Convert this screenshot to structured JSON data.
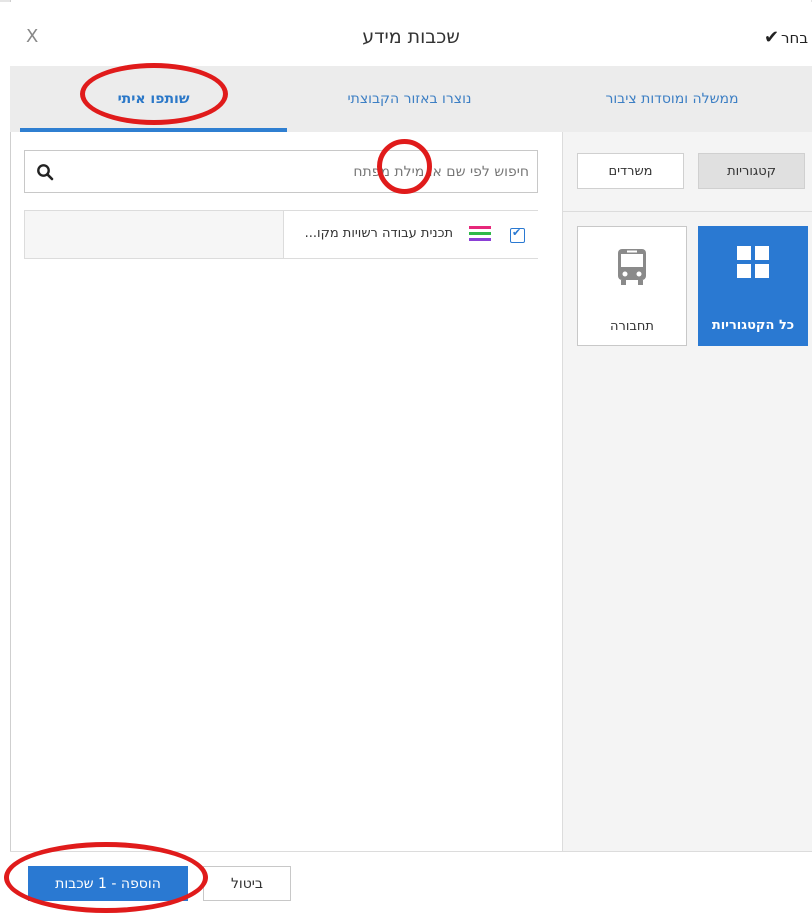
{
  "header": {
    "title": "שכבות מידע",
    "close_label": "X",
    "select_label": "בחר",
    "select_icon": "check-icon"
  },
  "tabs": [
    {
      "label": "ממשלה ומוסדות ציבור",
      "active": false
    },
    {
      "label": "נוצרו באזור הקבוצתי",
      "active": false
    },
    {
      "label": "שותפו איתי",
      "active": true
    }
  ],
  "side": {
    "toggle_categories": "קטגוריות",
    "toggle_offices": "משרדים",
    "categories": [
      {
        "label": "כל הקטגוריות",
        "icon": "grid-icon",
        "selected": true
      },
      {
        "label": "תחבורה",
        "icon": "bus-icon",
        "selected": false
      }
    ]
  },
  "search": {
    "placeholder": "חיפוש לפי שם או מילת מפתח",
    "icon": "search-icon"
  },
  "list": [
    {
      "label": "תכנית עבודה רשויות מקו...",
      "checked": true,
      "icon": "layers-icon"
    }
  ],
  "footer": {
    "add_label": "הוספה - 1 שכבות",
    "cancel_label": "ביטול"
  },
  "colors": {
    "accent": "#2a79d2",
    "annotation": "#e01b1b",
    "tab_bar": "#ececec",
    "layer_stripes": [
      "#e6287a",
      "#2fb84a",
      "#8b3fd6"
    ]
  }
}
